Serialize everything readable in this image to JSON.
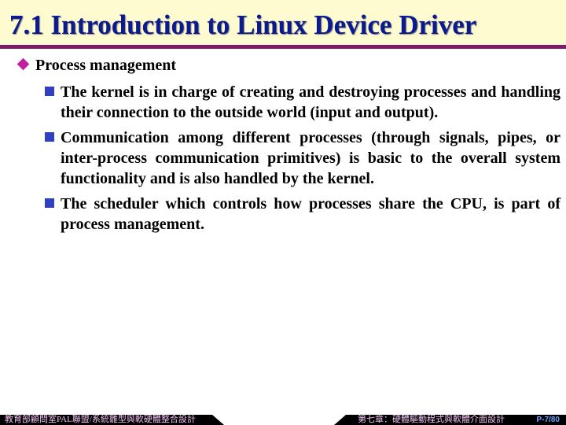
{
  "title": "7.1 Introduction to Linux Device Driver",
  "heading": "Process management",
  "bullets": [
    "The kernel is in charge of creating and destroying processes and handling their connection to the outside world (input and output).",
    "Communication among different processes (through signals, pipes, or inter-process communication primitives) is basic to the overall system functionality and is also handled by the kernel.",
    "The scheduler which controls how processes share the CPU, is part of process management."
  ],
  "footer": {
    "left": "教育部顧問室PAL聯盟/系統雛型與軟硬體整合設計",
    "right": "第七章：硬體驅動程式與軟體介面設計",
    "page": "P-7/80"
  }
}
